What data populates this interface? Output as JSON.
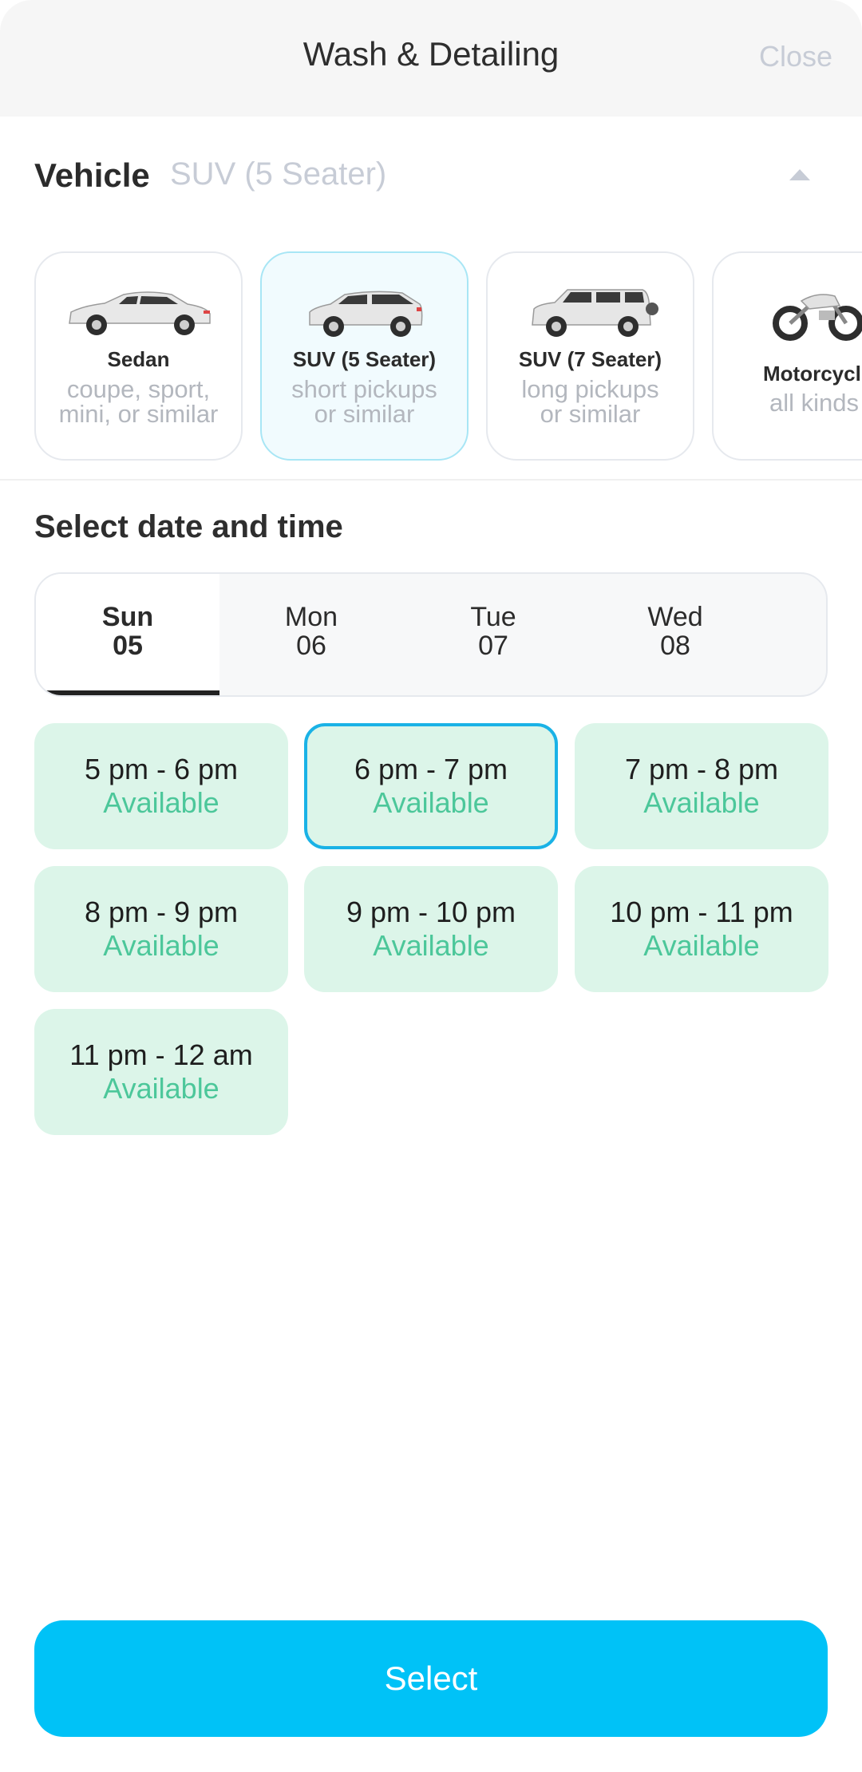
{
  "header": {
    "title": "Wash & Detailing",
    "close_label": "Close"
  },
  "vehicle": {
    "label": "Vehicle",
    "selected_value": "SUV (5 Seater)",
    "options": [
      {
        "name": "Sedan",
        "desc_line1": "coupe, sport,",
        "desc_line2": "mini, or similar",
        "icon": "sedan-car-icon"
      },
      {
        "name": "SUV (5 Seater)",
        "desc_line1": "short pickups",
        "desc_line2": "or similar",
        "icon": "suv-5-seater-icon"
      },
      {
        "name": "SUV (7 Seater)",
        "desc_line1": "long pickups",
        "desc_line2": "or similar",
        "icon": "suv-7-seater-icon"
      },
      {
        "name": "Motorcycl",
        "desc_line1": "all kinds",
        "desc_line2": "",
        "icon": "motorcycle-icon"
      }
    ]
  },
  "schedule": {
    "title": "Select date and time",
    "days": [
      {
        "name": "Sun",
        "date": "05"
      },
      {
        "name": "Mon",
        "date": "06"
      },
      {
        "name": "Tue",
        "date": "07"
      },
      {
        "name": "Wed",
        "date": "08"
      }
    ],
    "slots": [
      {
        "time": "5 pm - 6 pm",
        "status": "Available"
      },
      {
        "time": "6 pm - 7 pm",
        "status": "Available"
      },
      {
        "time": "7 pm - 8 pm",
        "status": "Available"
      },
      {
        "time": "8 pm - 9 pm",
        "status": "Available"
      },
      {
        "time": "9 pm - 10 pm",
        "status": "Available"
      },
      {
        "time": "10 pm - 11 pm",
        "status": "Available"
      },
      {
        "time": "11 pm - 12 am",
        "status": "Available"
      }
    ]
  },
  "footer": {
    "select_label": "Select"
  },
  "colors": {
    "accent": "#00c2f7",
    "slot_bg": "#dcf5e9",
    "available_text": "#4cc79a",
    "selected_border": "#1ab2e6"
  }
}
